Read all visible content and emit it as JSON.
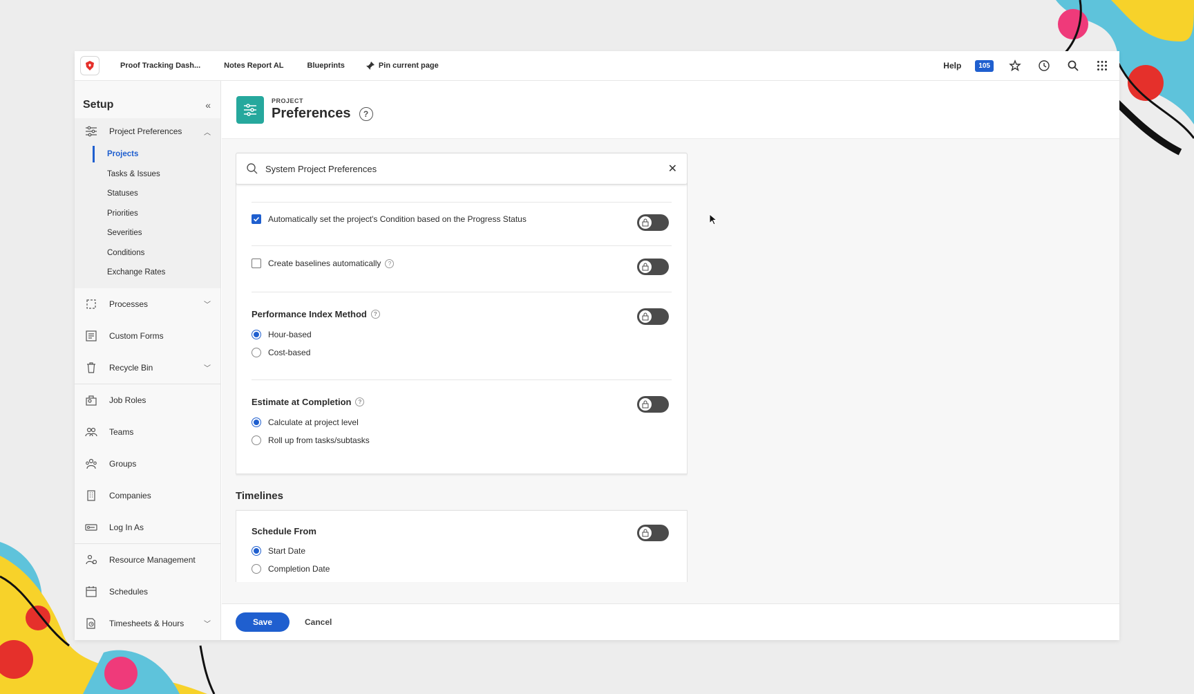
{
  "colors": {
    "accent": "#1f5fcf",
    "page_icon_bg": "#26a89d",
    "toggle": "#4b4b4b"
  },
  "topbar": {
    "pinned_tabs": [
      "Proof Tracking Dash...",
      "Notes Report AL",
      "Blueprints"
    ],
    "pin_current": "Pin current page",
    "help": "Help",
    "badge": "105"
  },
  "sidebar": {
    "title": "Setup",
    "project_preferences": "Project Preferences",
    "sub_items": [
      "Projects",
      "Tasks & Issues",
      "Statuses",
      "Priorities",
      "Severities",
      "Conditions",
      "Exchange Rates"
    ],
    "items": [
      "Processes",
      "Custom Forms",
      "Recycle Bin",
      "Job Roles",
      "Teams",
      "Groups",
      "Companies",
      "Log In As",
      "Resource Management",
      "Schedules",
      "Timesheets & Hours"
    ]
  },
  "page": {
    "eyebrow": "PROJECT",
    "title": "Preferences",
    "help_glyph": "?"
  },
  "search": {
    "value": "System Project Preferences"
  },
  "card1": {
    "auto_condition": "Automatically set the project's Condition based on the Progress Status",
    "baselines": "Create baselines automatically",
    "performance_title": "Performance Index Method",
    "performance_options": [
      "Hour-based",
      "Cost-based"
    ],
    "eac_title": "Estimate at Completion",
    "eac_options": [
      "Calculate at project level",
      "Roll up from tasks/subtasks"
    ]
  },
  "timelines": {
    "label": "Timelines",
    "schedule_title": "Schedule From",
    "schedule_options": [
      "Start Date",
      "Completion Date"
    ]
  },
  "footer": {
    "save": "Save",
    "cancel": "Cancel"
  }
}
